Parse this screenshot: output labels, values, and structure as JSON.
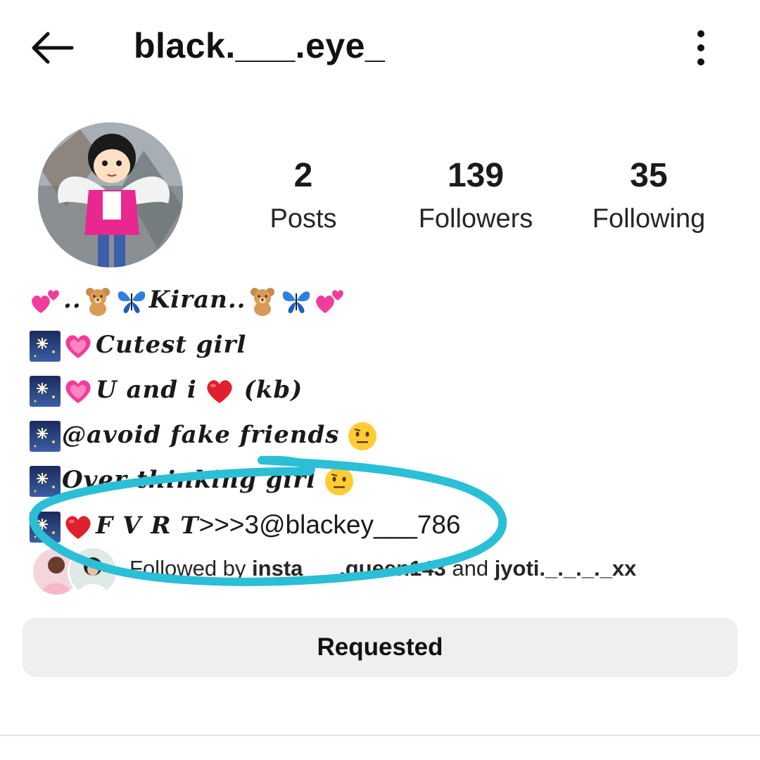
{
  "header": {
    "username": "black.___.eye_",
    "back_icon": "arrow-left-icon",
    "menu_icon": "more-vertical-icon"
  },
  "stats": {
    "posts_count": "2",
    "posts_label": "Posts",
    "followers_count": "139",
    "followers_label": "Followers",
    "following_count": "35",
    "following_label": "Following"
  },
  "bio": {
    "line1_text": "..",
    "line1_name": "Kiran..",
    "line2_text": "Cutest girl",
    "line3_text": "U and i",
    "line3_suffix": "(kb)",
    "line4_text": "@avoid fake friends",
    "line5_text": "Over thinking girl",
    "line6_fancy": "F V R T",
    "line6_plain": ">>>3@blackey___786"
  },
  "followed_by": {
    "prefix": "Followed by ",
    "user1": "insta___.queen143",
    "conjunction": " and ",
    "user2": "jyoti._._._._xx"
  },
  "actions": {
    "requested_label": "Requested"
  },
  "colors": {
    "annotation": "#2bbfd6",
    "button_bg": "#efefef",
    "heart": "#e0202e",
    "pink_heart": "#f03d9a"
  }
}
